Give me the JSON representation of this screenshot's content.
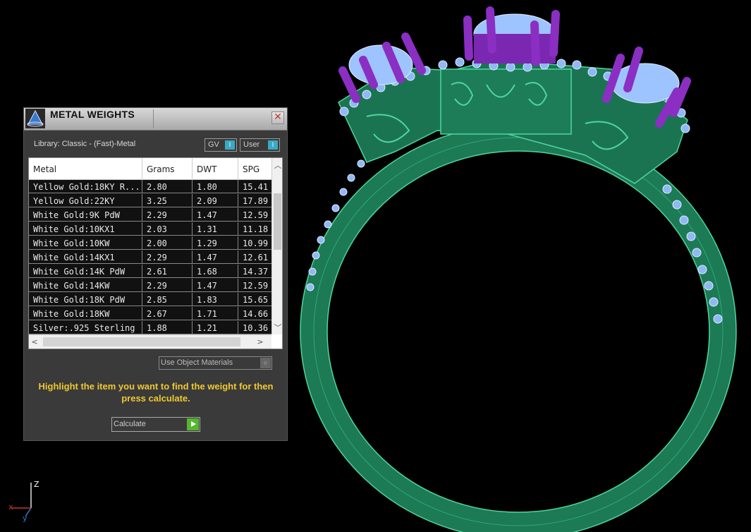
{
  "panel": {
    "title": "METAL WEIGHTS",
    "close": "✕",
    "library": "Library: Classic - (Fast)-Metal",
    "gv_label": "GV",
    "user_label": "User",
    "toggle_knob": "I",
    "columns": [
      "Metal",
      "Grams",
      "DWT",
      "SPG"
    ],
    "rows": [
      [
        "Yellow Gold:18KY R...",
        "2.80",
        "1.80",
        "15.41"
      ],
      [
        "Yellow Gold:22KY",
        "3.25",
        "2.09",
        "17.89"
      ],
      [
        "White Gold:9K PdW",
        "2.29",
        "1.47",
        "12.59"
      ],
      [
        "White Gold:10KX1",
        "2.03",
        "1.31",
        "11.18"
      ],
      [
        "White Gold:10KW",
        "2.00",
        "1.29",
        "10.99"
      ],
      [
        "White Gold:14KX1",
        "2.29",
        "1.47",
        "12.61"
      ],
      [
        "White Gold:14K PdW",
        "2.61",
        "1.68",
        "14.37"
      ],
      [
        "White Gold:14KW",
        "2.29",
        "1.47",
        "12.59"
      ],
      [
        "White Gold:18K PdW",
        "2.85",
        "1.83",
        "15.65"
      ],
      [
        "White Gold:18KW",
        "2.67",
        "1.71",
        "14.66"
      ],
      [
        "Silver:.925 Sterling",
        "1.88",
        "1.21",
        "10.36"
      ]
    ],
    "use_object_materials": "Use Object Materials",
    "instruction": "Highlight the item you want to find the weight for then press calculate.",
    "calculate": "Calculate"
  },
  "axes": {
    "z": "Z",
    "x": "x",
    "y": "y"
  },
  "colors": {
    "metal": "#1f8a5e",
    "edge": "#54e0a8",
    "prong": "#8a2fc2",
    "gem": "#9ec4ff",
    "highlight": "#f0c830"
  }
}
